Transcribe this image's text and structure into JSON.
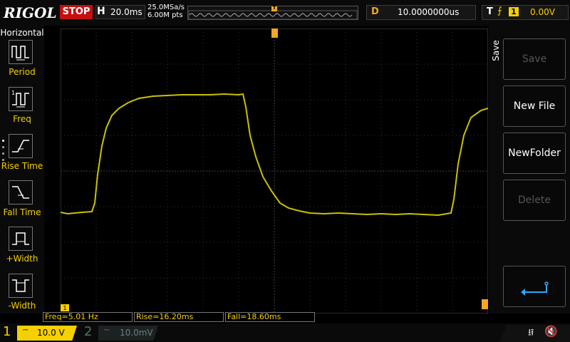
{
  "brand": "RIGOL",
  "run_state": "STOP",
  "horizontal": {
    "letter": "H",
    "time_scale": "20.0ms",
    "sample_rate": "25.0MSa/s",
    "memory_depth": "6.00M pts",
    "trigger_marker": "T"
  },
  "delay": {
    "letter": "D",
    "value": "10.0000000us"
  },
  "trigger": {
    "letter": "T",
    "edge_symbol": "⨍",
    "source": "1",
    "level": "0.00V"
  },
  "left_menu": {
    "title": "Horizontal",
    "items": [
      {
        "label": "Period",
        "icon": "period-icon"
      },
      {
        "label": "Freq",
        "icon": "frequency-icon"
      },
      {
        "label": "Rise Time",
        "icon": "rise-time-icon"
      },
      {
        "label": "Fall Time",
        "icon": "fall-time-icon"
      },
      {
        "label": "+Width",
        "icon": "positive-width-icon"
      },
      {
        "label": "-Width",
        "icon": "negative-width-icon"
      }
    ]
  },
  "right_menu": {
    "title": "Save",
    "buttons": [
      {
        "label": "Save",
        "enabled": false
      },
      {
        "label": "New File",
        "enabled": true
      },
      {
        "label": "NewFolder",
        "enabled": true
      },
      {
        "label": "Delete",
        "enabled": false
      }
    ],
    "back_icon": "return-arrow-icon"
  },
  "measurements": {
    "freq": "Freq=5.01 Hz",
    "rise": "Rise=16.20ms",
    "fall": "Fall=18.60ms"
  },
  "channels": {
    "ch1": {
      "number": "1",
      "coupling_symbol": "⎓",
      "scale": "10.0 V"
    },
    "ch2": {
      "number": "2",
      "coupling_symbol": "⎓",
      "scale": "10.0mV"
    }
  },
  "markers": {
    "ch1_ground": "1"
  },
  "status_icons": [
    "usb-icon",
    "speaker-muted-icon"
  ],
  "colors": {
    "ch1": "#f5d000",
    "accent": "#f5a623",
    "stop": "#c41010"
  }
}
